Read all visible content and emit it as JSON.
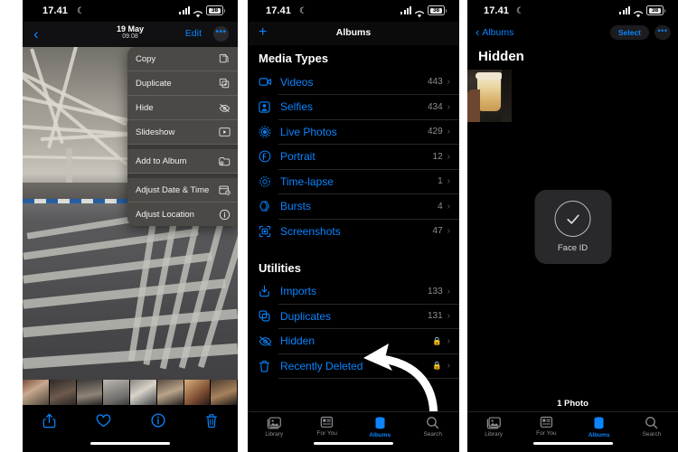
{
  "status_bar": {
    "time": "17.41",
    "dnd_icon": "crescent-moon-icon",
    "battery": "38"
  },
  "panel1": {
    "nav": {
      "back_icon": "chevron-left-icon",
      "date": "19 May",
      "time": "09.08",
      "edit_label": "Edit",
      "more_label": "•••"
    },
    "context_menu": {
      "groups": [
        {
          "items": [
            {
              "label": "Copy",
              "icon": "copy-icon"
            },
            {
              "label": "Duplicate",
              "icon": "duplicate-icon"
            },
            {
              "label": "Hide",
              "icon": "eye-slash-icon"
            },
            {
              "label": "Slideshow",
              "icon": "play-rectangle-icon"
            }
          ]
        },
        {
          "items": [
            {
              "label": "Add to Album",
              "icon": "add-to-album-icon"
            }
          ]
        },
        {
          "items": [
            {
              "label": "Adjust Date & Time",
              "icon": "calendar-clock-icon"
            },
            {
              "label": "Adjust Location",
              "icon": "location-info-icon"
            }
          ]
        }
      ]
    },
    "toolbar": [
      {
        "name": "share-button",
        "icon": "share-icon"
      },
      {
        "name": "favorite-button",
        "icon": "heart-icon"
      },
      {
        "name": "info-button",
        "icon": "info-circle-icon"
      },
      {
        "name": "delete-button",
        "icon": "trash-icon"
      }
    ]
  },
  "panel2": {
    "nav": {
      "add_icon": "plus-icon",
      "title": "Albums"
    },
    "sections": [
      {
        "heading": "Media Types",
        "rows": [
          {
            "label": "Videos",
            "count": "443",
            "icon": "video-icon",
            "locked": false
          },
          {
            "label": "Selfies",
            "count": "434",
            "icon": "selfie-icon",
            "locked": false
          },
          {
            "label": "Live Photos",
            "count": "429",
            "icon": "live-photo-icon",
            "locked": false
          },
          {
            "label": "Portrait",
            "count": "12",
            "icon": "portrait-icon",
            "locked": false
          },
          {
            "label": "Time-lapse",
            "count": "1",
            "icon": "timelapse-icon",
            "locked": false
          },
          {
            "label": "Bursts",
            "count": "4",
            "icon": "bursts-icon",
            "locked": false
          },
          {
            "label": "Screenshots",
            "count": "47",
            "icon": "screenshot-icon",
            "locked": false
          }
        ]
      },
      {
        "heading": "Utilities",
        "rows": [
          {
            "label": "Imports",
            "count": "133",
            "icon": "import-icon",
            "locked": false
          },
          {
            "label": "Duplicates",
            "count": "131",
            "icon": "duplicates-icon",
            "locked": false
          },
          {
            "label": "Hidden",
            "count": "",
            "icon": "eye-slash-icon",
            "locked": true
          },
          {
            "label": "Recently Deleted",
            "count": "",
            "icon": "trash-icon",
            "locked": true
          }
        ]
      }
    ],
    "annotation": {
      "shape": "curved-arrow",
      "points_to": "Hidden"
    },
    "tabs": [
      {
        "label": "Library",
        "icon": "library-icon",
        "active": false
      },
      {
        "label": "For You",
        "icon": "for-you-icon",
        "active": false
      },
      {
        "label": "Albums",
        "icon": "albums-icon",
        "active": true
      },
      {
        "label": "Search",
        "icon": "search-icon",
        "active": false
      }
    ]
  },
  "panel3": {
    "nav": {
      "back_label": "Albums",
      "back_icon": "chevron-left-icon",
      "select_label": "Select",
      "more_label": "•••"
    },
    "title": "Hidden",
    "thumbnail": {
      "alt": "hand-holding-iced-drink"
    },
    "faceid": {
      "icon": "checkmark-circle-icon",
      "label": "Face ID"
    },
    "count_label": "1 Photo",
    "tabs": [
      {
        "label": "Library",
        "icon": "library-icon",
        "active": false
      },
      {
        "label": "For You",
        "icon": "for-you-icon",
        "active": false
      },
      {
        "label": "Albums",
        "icon": "albums-icon",
        "active": true
      },
      {
        "label": "Search",
        "icon": "search-icon",
        "active": false
      }
    ]
  },
  "colors": {
    "accent": "#0a84ff",
    "secondary_text": "#8e8e93",
    "menu_bg": "#4a4946"
  }
}
